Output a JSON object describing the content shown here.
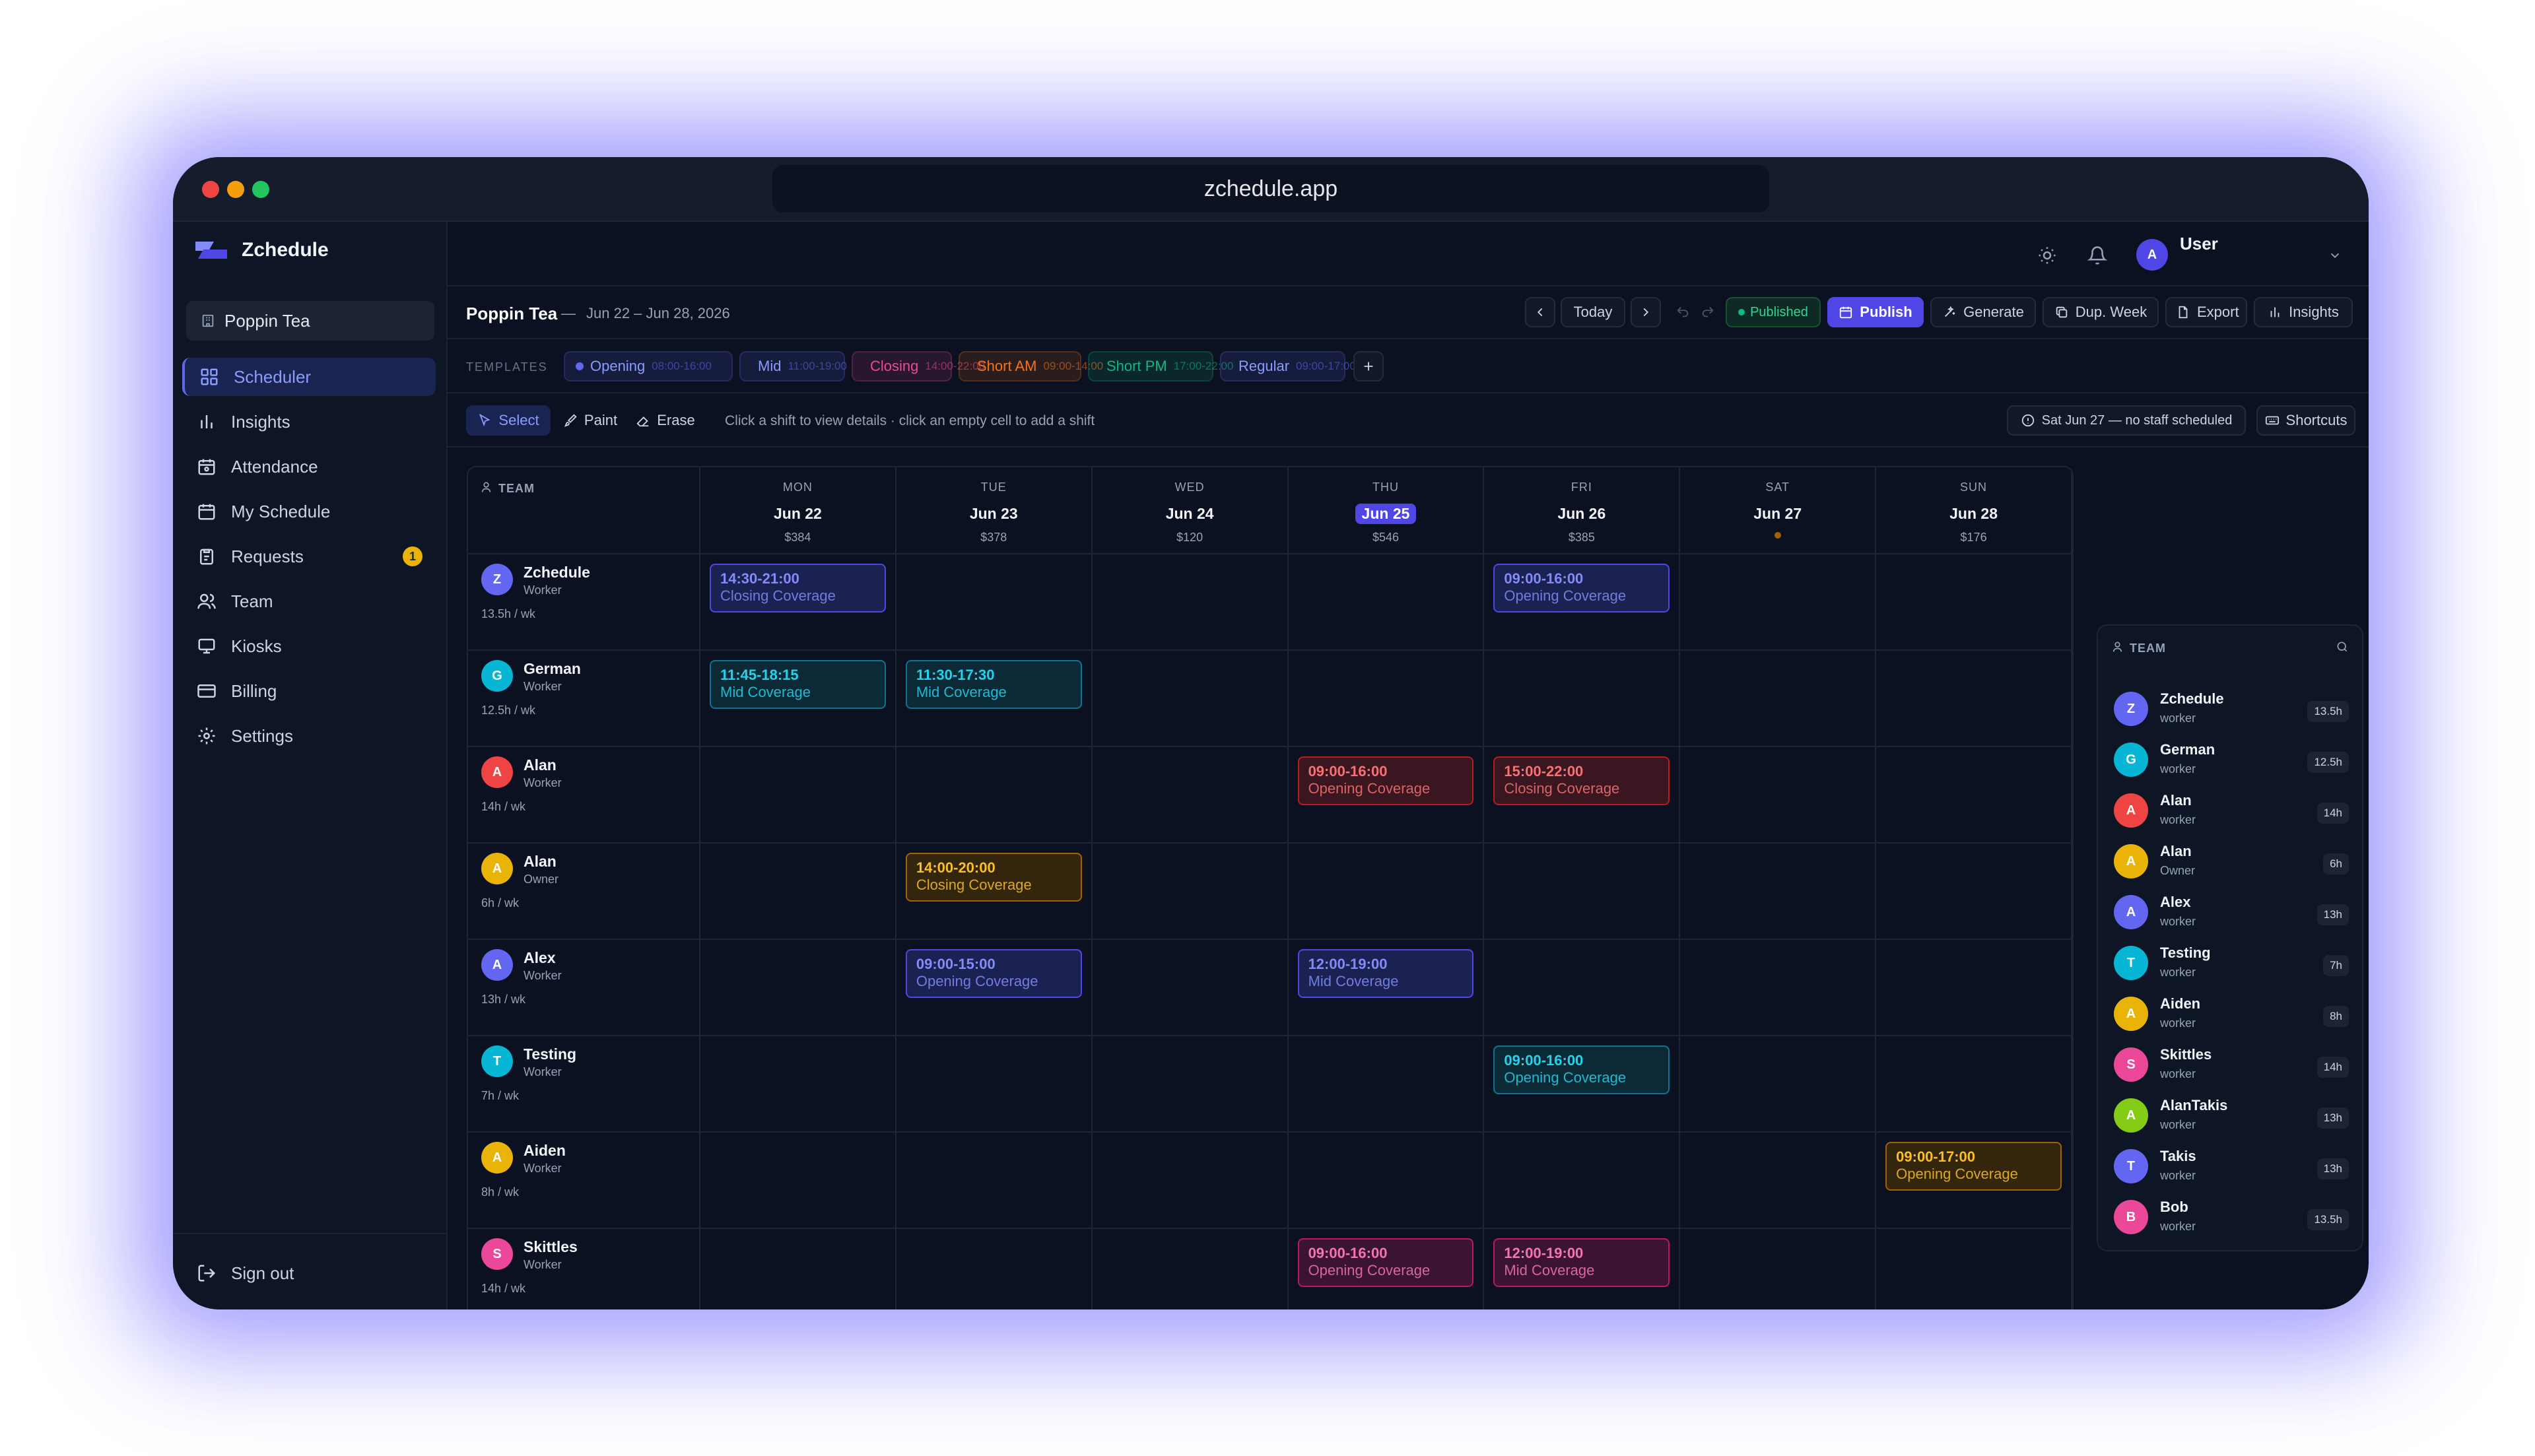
{
  "browser": {
    "url": "zchedule.app"
  },
  "brand": {
    "name": "Zchedule"
  },
  "sidebar": {
    "org": "Poppin Tea",
    "items": [
      {
        "label": "Scheduler",
        "icon": "grid-icon"
      },
      {
        "label": "Insights",
        "icon": "bar-chart-icon"
      },
      {
        "label": "Attendance",
        "icon": "clock-calendar-icon"
      },
      {
        "label": "My Schedule",
        "icon": "calendar-icon"
      },
      {
        "label": "Requests",
        "icon": "clipboard-icon",
        "badge": "1"
      },
      {
        "label": "Team",
        "icon": "users-icon"
      },
      {
        "label": "Kiosks",
        "icon": "monitor-icon"
      },
      {
        "label": "Billing",
        "icon": "credit-card-icon"
      },
      {
        "label": "Settings",
        "icon": "gear-icon"
      }
    ],
    "signout": "Sign out"
  },
  "topbar": {
    "user": "User",
    "avatar": "A"
  },
  "header": {
    "org": "Poppin Tea",
    "sep": "—",
    "range": "Jun 22 – Jun 28, 2026",
    "today": "Today",
    "status": "Published",
    "publish": "Publish",
    "generate": "Generate",
    "dup": "Dup. Week",
    "export": "Export",
    "insights": "Insights"
  },
  "templates": {
    "label": "TEMPLATES",
    "items": [
      {
        "name": "Opening",
        "time": "08:00-16:00",
        "color": "#6366f1"
      },
      {
        "name": "Mid",
        "time": "11:00-19:00",
        "color": "#6366f1"
      },
      {
        "name": "Closing",
        "time": "14:00-22:00",
        "color": "#ec4899"
      },
      {
        "name": "Short AM",
        "time": "09:00-14:00",
        "color": "#f97316"
      },
      {
        "name": "Short PM",
        "time": "17:00-22:00",
        "color": "#10b981"
      },
      {
        "name": "Regular",
        "time": "09:00-17:00",
        "color": "#6366f1"
      }
    ]
  },
  "tools": {
    "select": "Select",
    "paint": "Paint",
    "erase": "Erase",
    "hint": "Click a shift to view details · click an empty cell to add a shift",
    "warning": "Sat Jun 27 — no staff scheduled",
    "shortcuts": "Shortcuts"
  },
  "grid": {
    "team_label": "TEAM",
    "days": [
      {
        "dow": "MON",
        "date": "Jun 22",
        "cost": "$384"
      },
      {
        "dow": "TUE",
        "date": "Jun 23",
        "cost": "$378"
      },
      {
        "dow": "WED",
        "date": "Jun 24",
        "cost": "$120"
      },
      {
        "dow": "THU",
        "date": "Jun 25",
        "cost": "$546",
        "today": true
      },
      {
        "dow": "FRI",
        "date": "Jun 26",
        "cost": "$385"
      },
      {
        "dow": "SAT",
        "date": "Jun 27",
        "cost": ""
      },
      {
        "dow": "SUN",
        "date": "Jun 28",
        "cost": "$176"
      }
    ],
    "rows": [
      {
        "name": "Zchedule",
        "role": "Worker",
        "hours": "13.5h / wk",
        "initial": "Z",
        "color": "#6366f1",
        "shifts": [
          {
            "day": 0,
            "time": "14:30-21:00",
            "label": "Closing Coverage",
            "tone": "indigo"
          },
          {
            "day": 4,
            "time": "09:00-16:00",
            "label": "Opening Coverage",
            "tone": "indigo"
          }
        ]
      },
      {
        "name": "German",
        "role": "Worker",
        "hours": "12.5h / wk",
        "initial": "G",
        "color": "#06b6d4",
        "shifts": [
          {
            "day": 0,
            "time": "11:45-18:15",
            "label": "Mid Coverage",
            "tone": "cyan"
          },
          {
            "day": 1,
            "time": "11:30-17:30",
            "label": "Mid Coverage",
            "tone": "cyan"
          }
        ]
      },
      {
        "name": "Alan",
        "role": "Worker",
        "hours": "14h / wk",
        "initial": "A",
        "color": "#ef4444",
        "shifts": [
          {
            "day": 3,
            "time": "09:00-16:00",
            "label": "Opening Coverage",
            "tone": "red"
          },
          {
            "day": 4,
            "time": "15:00-22:00",
            "label": "Closing Coverage",
            "tone": "red"
          }
        ]
      },
      {
        "name": "Alan",
        "role": "Owner",
        "hours": "6h / wk",
        "initial": "A",
        "color": "#eab308",
        "shifts": [
          {
            "day": 1,
            "time": "14:00-20:00",
            "label": "Closing Coverage",
            "tone": "amber"
          }
        ]
      },
      {
        "name": "Alex",
        "role": "Worker",
        "hours": "13h / wk",
        "initial": "A",
        "color": "#6366f1",
        "shifts": [
          {
            "day": 1,
            "time": "09:00-15:00",
            "label": "Opening Coverage",
            "tone": "indigo"
          },
          {
            "day": 3,
            "time": "12:00-19:00",
            "label": "Mid Coverage",
            "tone": "indigo"
          }
        ]
      },
      {
        "name": "Testing",
        "role": "Worker",
        "hours": "7h / wk",
        "initial": "T",
        "color": "#06b6d4",
        "shifts": [
          {
            "day": 4,
            "time": "09:00-16:00",
            "label": "Opening Coverage",
            "tone": "cyan"
          }
        ]
      },
      {
        "name": "Aiden",
        "role": "Worker",
        "hours": "8h / wk",
        "initial": "A",
        "color": "#eab308",
        "shifts": [
          {
            "day": 6,
            "time": "09:00-17:00",
            "label": "Opening Coverage",
            "tone": "amber"
          }
        ]
      },
      {
        "name": "Skittles",
        "role": "Worker",
        "hours": "14h / wk",
        "initial": "S",
        "color": "#ec4899",
        "shifts": [
          {
            "day": 3,
            "time": "09:00-16:00",
            "label": "Opening Coverage",
            "tone": "pink"
          },
          {
            "day": 4,
            "time": "12:00-19:00",
            "label": "Mid Coverage",
            "tone": "pink"
          }
        ]
      }
    ]
  },
  "team_panel": {
    "title": "TEAM",
    "members": [
      {
        "name": "Zchedule",
        "role": "worker",
        "hours": "13.5h",
        "initial": "Z",
        "color": "#6366f1"
      },
      {
        "name": "German",
        "role": "worker",
        "hours": "12.5h",
        "initial": "G",
        "color": "#06b6d4"
      },
      {
        "name": "Alan",
        "role": "worker",
        "hours": "14h",
        "initial": "A",
        "color": "#ef4444"
      },
      {
        "name": "Alan",
        "role": "Owner",
        "hours": "6h",
        "initial": "A",
        "color": "#eab308"
      },
      {
        "name": "Alex",
        "role": "worker",
        "hours": "13h",
        "initial": "A",
        "color": "#6366f1"
      },
      {
        "name": "Testing",
        "role": "worker",
        "hours": "7h",
        "initial": "T",
        "color": "#06b6d4"
      },
      {
        "name": "Aiden",
        "role": "worker",
        "hours": "8h",
        "initial": "A",
        "color": "#eab308"
      },
      {
        "name": "Skittles",
        "role": "worker",
        "hours": "14h",
        "initial": "S",
        "color": "#ec4899"
      },
      {
        "name": "AlanTakis",
        "role": "worker",
        "hours": "13h",
        "initial": "A",
        "color": "#84cc16"
      },
      {
        "name": "Takis",
        "role": "worker",
        "hours": "13h",
        "initial": "T",
        "color": "#6366f1"
      },
      {
        "name": "Bob",
        "role": "worker",
        "hours": "13.5h",
        "initial": "B",
        "color": "#ec4899"
      }
    ]
  },
  "colors": {
    "accent": "#4f46e5",
    "published": "#10b981",
    "badge": "#eab308"
  }
}
